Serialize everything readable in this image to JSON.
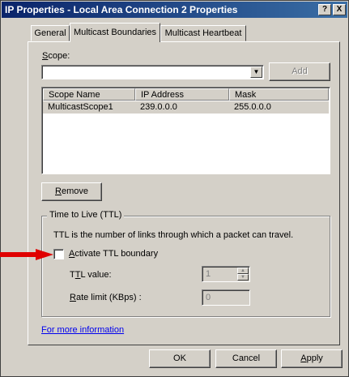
{
  "window": {
    "title": "IP Properties - Local Area Connection 2 Properties"
  },
  "titlebar_buttons": {
    "help": "?",
    "close": "X"
  },
  "tabs": [
    "General",
    "Multicast Boundaries",
    "Multicast Heartbeat"
  ],
  "scope": {
    "label": "Scope:",
    "value": "",
    "add_button": "Add"
  },
  "table": {
    "columns": [
      "Scope Name",
      "IP Address",
      "Mask"
    ],
    "rows": [
      {
        "name": "MulticastScope1",
        "ip": "239.0.0.0",
        "mask": "255.0.0.0"
      }
    ]
  },
  "remove_button": "Remove",
  "ttl": {
    "group_title": "Time to Live (TTL)",
    "description": "TTL is the number of links through which a packet can travel.",
    "activate_label": "Activate TTL boundary",
    "activate_checked": false,
    "ttl_value_label": "TTL value:",
    "ttl_value": "1",
    "rate_limit_label": "Rate limit (KBps) :",
    "rate_limit_value": "0"
  },
  "more_info_link": "For more information",
  "footer": {
    "ok": "OK",
    "cancel": "Cancel",
    "apply": "Apply"
  },
  "annotation_arrow_color": "#e00000"
}
